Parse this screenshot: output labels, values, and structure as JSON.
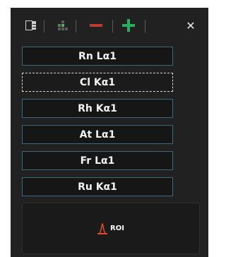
{
  "toolbar": {
    "icons": [
      "panel-layout-icon",
      "grid-icon",
      "remove-icon",
      "add-icon",
      "close-icon"
    ],
    "close_glyph": "✕",
    "colors": {
      "remove": "#c0392b",
      "add": "#27ae60"
    }
  },
  "items": [
    {
      "label": "Rn Lα1"
    },
    {
      "label": "Cl Kα1"
    },
    {
      "label": "Rh Kα1"
    },
    {
      "label": "At Lα1"
    },
    {
      "label": "Fr Lα1"
    },
    {
      "label": "Ru Kα1"
    }
  ],
  "roi": {
    "label": "ROI",
    "icon": "roi-peak-icon",
    "color": "#d94a2a"
  }
}
